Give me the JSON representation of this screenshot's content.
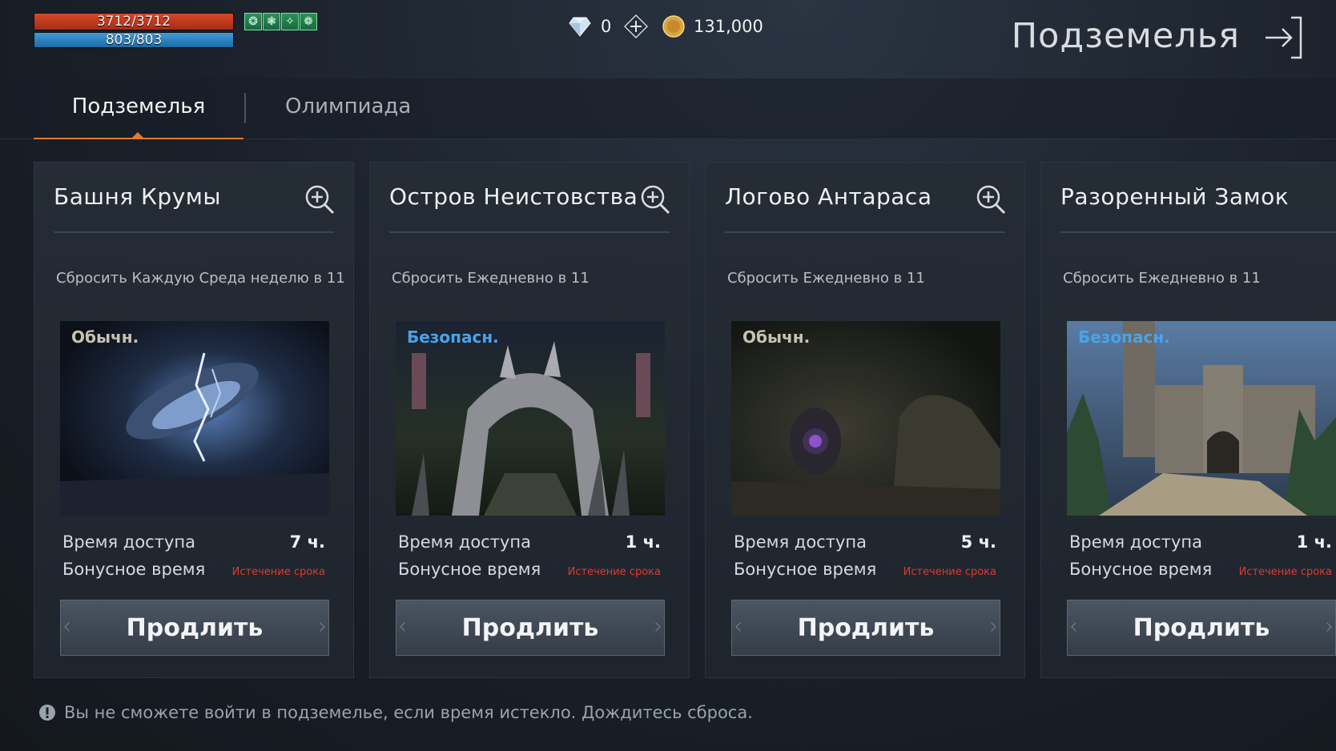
{
  "hud": {
    "hp": "3712/3712",
    "mp": "803/803",
    "buffs": [
      "❂",
      "❃",
      "✧",
      "❁"
    ]
  },
  "currency": {
    "gems": "0",
    "gold": "131,000"
  },
  "header": {
    "title": "Подземелья"
  },
  "tabs": [
    {
      "label": "Подземелья",
      "active": true
    },
    {
      "label": "Олимпиада",
      "active": false
    }
  ],
  "labels": {
    "access_time": "Время доступа",
    "bonus_time": "Бонусное время",
    "expired": "Истечение срока",
    "extend": "Продлить"
  },
  "cards": [
    {
      "title": "Башня Крумы",
      "reset": "Сбросить Каждую Среда неделю в 11",
      "tag": "Обычн.",
      "hours": "7 ч."
    },
    {
      "title": "Остров Неистовства",
      "reset": "Сбросить Ежедневно в 11",
      "tag": "Безопасн.",
      "hours": "1 ч."
    },
    {
      "title": "Логово Антараса",
      "reset": "Сбросить Ежедневно в 11",
      "tag": "Обычн.",
      "hours": "5 ч."
    },
    {
      "title": "Разоренный Замок",
      "reset": "Сбросить Ежедневно в 11",
      "tag": "Безопасн.",
      "hours": "1 ч."
    }
  ],
  "notice": "Вы не сможете войти в подземелье, если время истекло. Дождитесь сброса.",
  "colors": {
    "accent": "#e07b2e",
    "safe_tag": "#4aa3e8",
    "expired": "#e0392e",
    "hp_bar": "#c13a1f",
    "mp_bar": "#2f84c2"
  }
}
